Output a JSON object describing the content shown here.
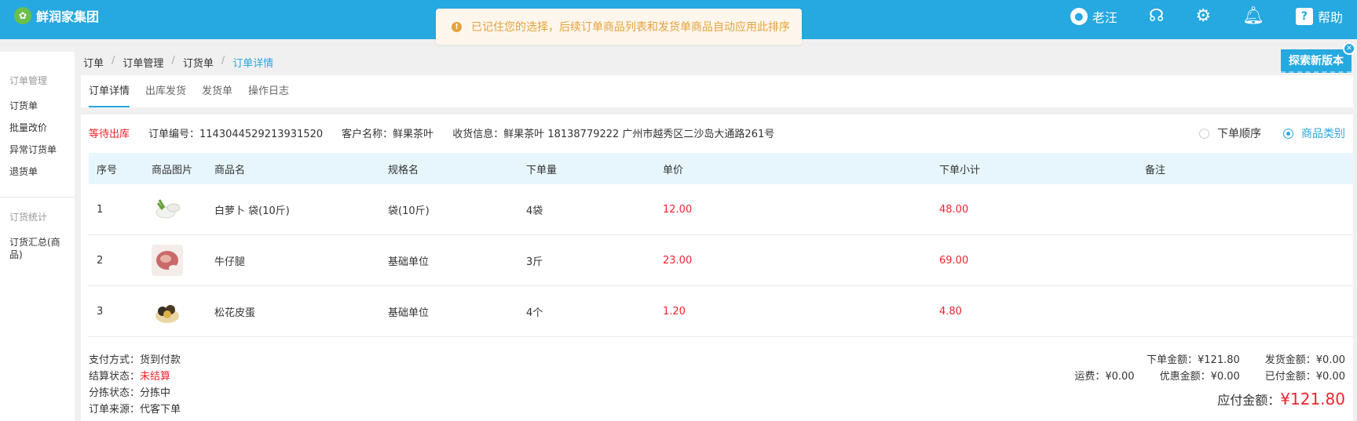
{
  "topbar": {
    "brand": "鲜润家集团",
    "user": "老汪",
    "help": "帮助"
  },
  "toast": {
    "message": "已记住您的选择，后续订单商品列表和发货单商品自动应用此排序"
  },
  "sidebar": {
    "group1": "订单管理",
    "items1": [
      "订货单",
      "批量改价",
      "异常订货单",
      "退货单"
    ],
    "group2": "订货统计",
    "items2": [
      "订货汇总(商品)"
    ]
  },
  "breadcrumb": {
    "items": [
      "订单",
      "订单管理",
      "订货单",
      "订单详情"
    ],
    "sep": "/"
  },
  "explore": {
    "label": "探索新版本"
  },
  "tabs": [
    {
      "label": "订单详情",
      "active": true
    },
    {
      "label": "出库发货",
      "active": false
    },
    {
      "label": "发货单",
      "active": false
    },
    {
      "label": "操作日志",
      "active": false
    }
  ],
  "order": {
    "status": "等待出库",
    "order_no": "订单编号：1143044529213931520",
    "customer": "客户名称：鲜果茶叶",
    "shipping": "收货信息：鲜果茶叶 18138779222 广州市越秀区二沙岛大通路261号"
  },
  "sort": {
    "options": [
      "下单顺序",
      "商品类别"
    ],
    "selected": "商品类别"
  },
  "table": {
    "headers": [
      "序号",
      "商品图片",
      "商品名",
      "规格名",
      "下单量",
      "单价",
      "下单小计",
      "备注"
    ],
    "rows": [
      {
        "no": "1",
        "name": "白萝卜 袋(10斤)",
        "spec": "袋(10斤)",
        "qty": "4袋",
        "price": "12.00",
        "subtotal": "48.00",
        "note": ""
      },
      {
        "no": "2",
        "name": "牛仔腿",
        "spec": "基础单位",
        "qty": "3斤",
        "price": "23.00",
        "subtotal": "69.00",
        "note": ""
      },
      {
        "no": "3",
        "name": "松花皮蛋",
        "spec": "基础单位",
        "qty": "4个",
        "price": "1.20",
        "subtotal": "4.80",
        "note": ""
      }
    ]
  },
  "payment": {
    "method_label": "支付方式：",
    "method": "货到付款",
    "settle_label": "结算状态：",
    "settle": "未结算",
    "sort_label": "分拣状态：",
    "sort_status": "分拣中",
    "source_label": "订单来源：",
    "source": "代客下单"
  },
  "totals": {
    "order_amount": "下单金额：¥121.80",
    "ship_amount": "发货金额：¥0.00",
    "freight": "运费：¥0.00",
    "discount": "优惠金额：¥0.00",
    "paid": "已付金额：¥0.00",
    "payable_label": "应付金额：",
    "payable": "¥121.80"
  },
  "colors": {
    "primary": "#26a8e0",
    "danger": "#f5222d",
    "warning": "#e6a23c"
  }
}
